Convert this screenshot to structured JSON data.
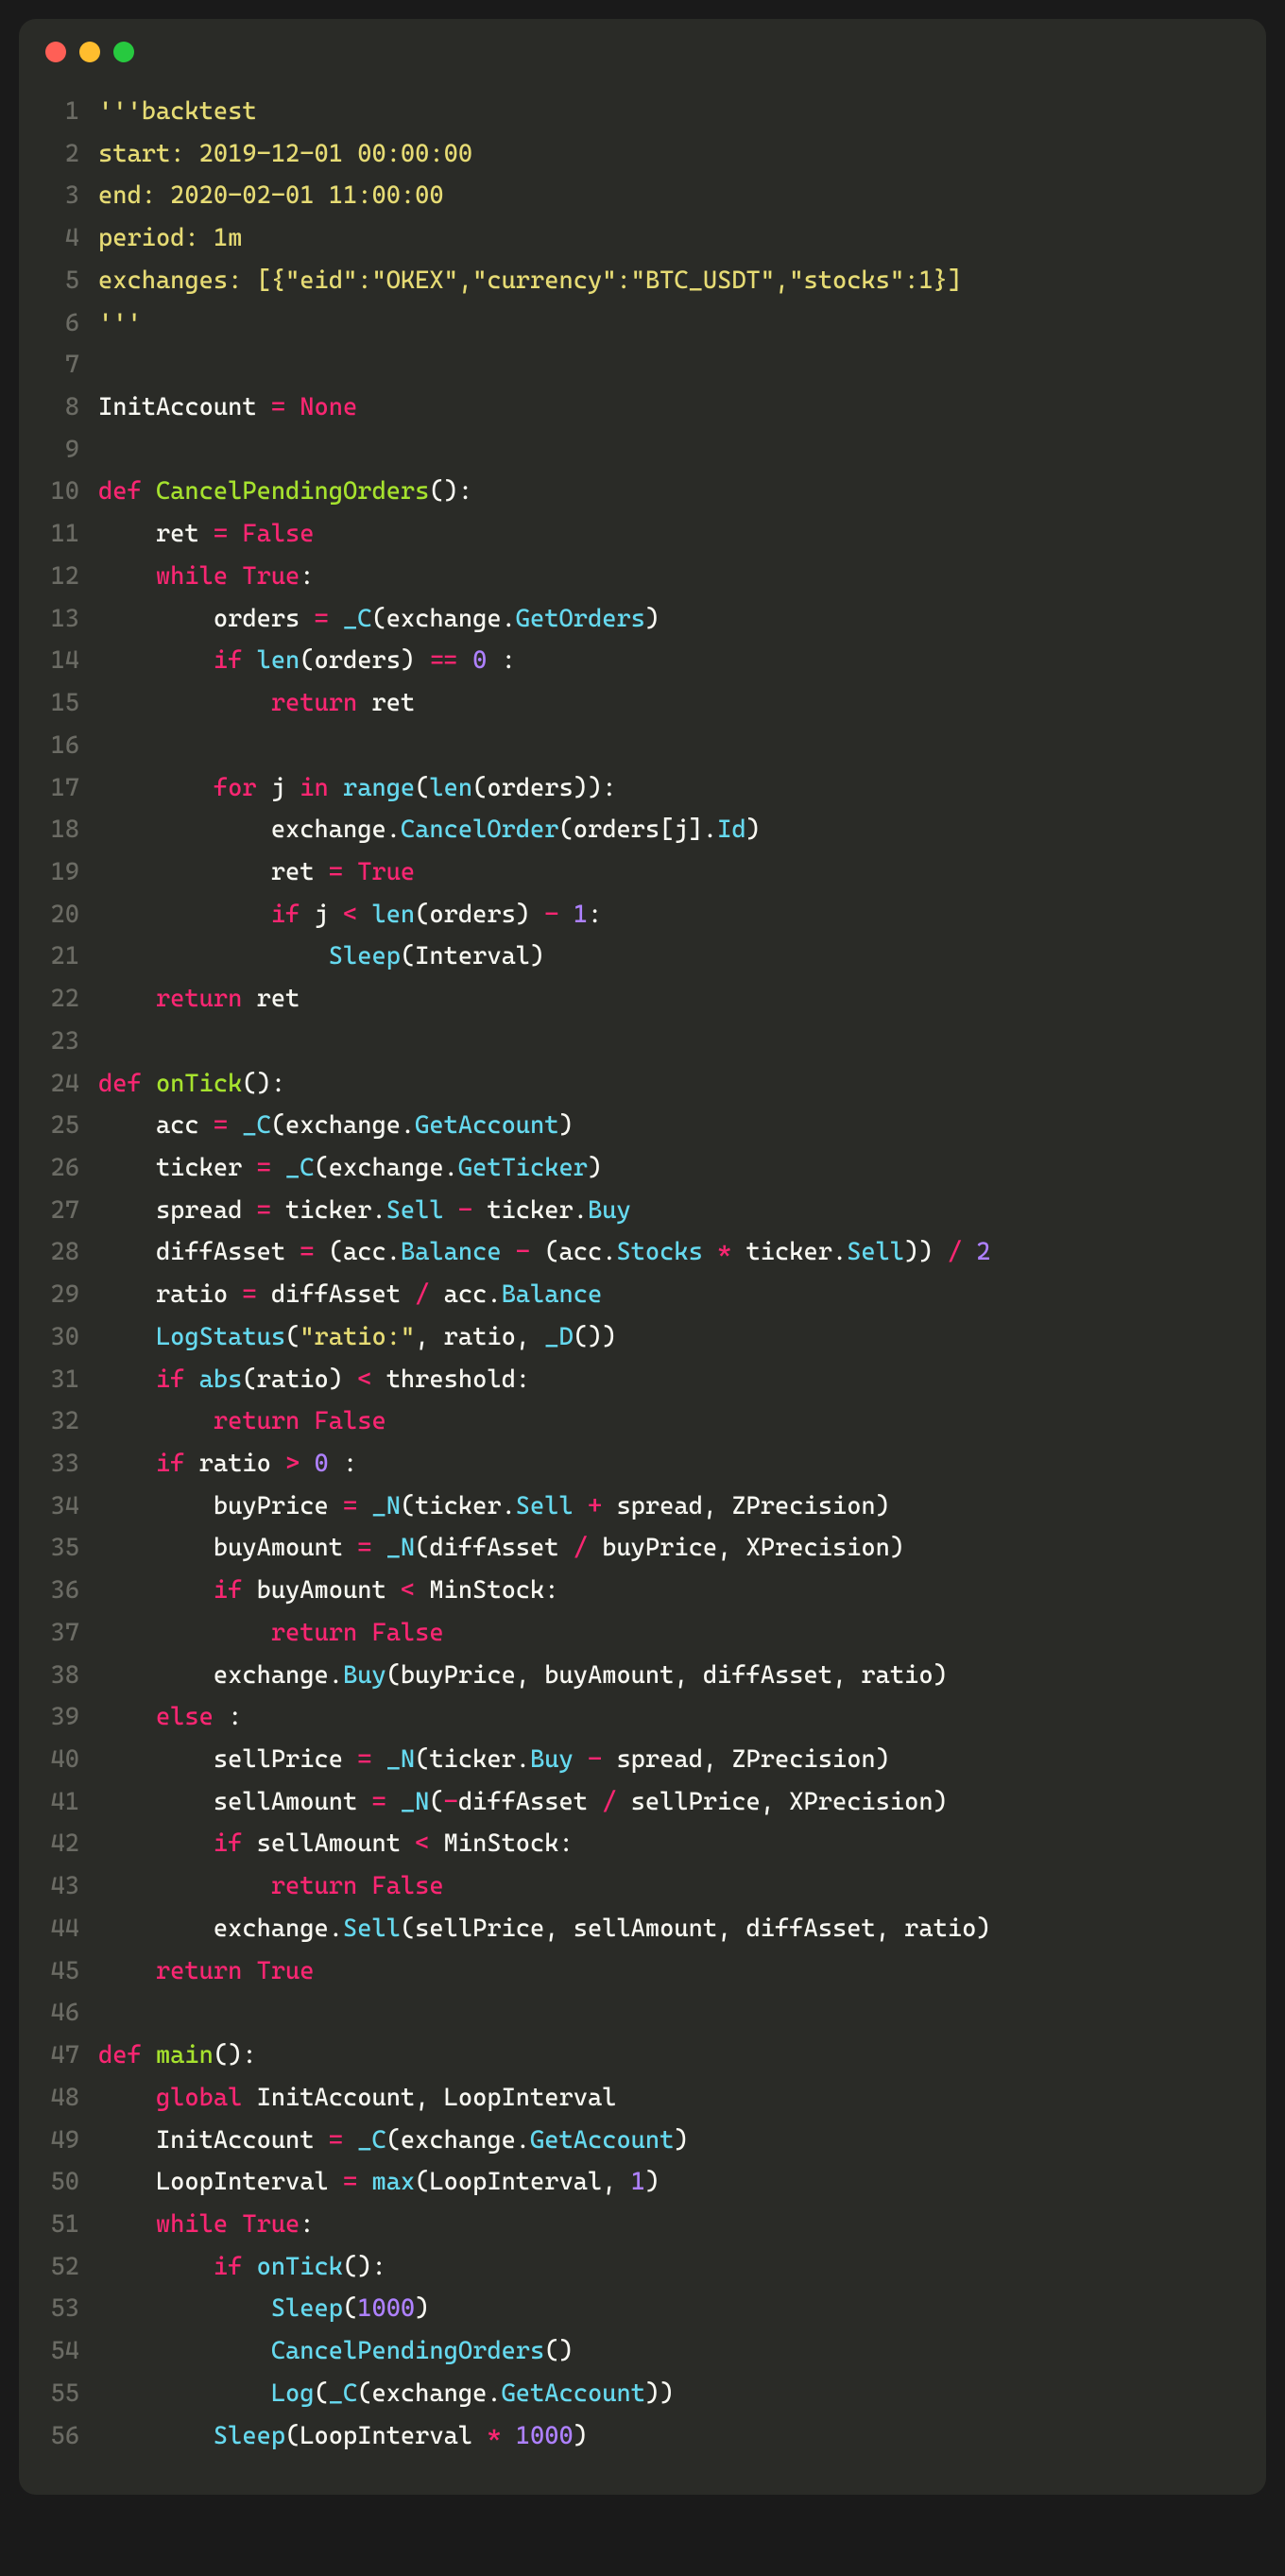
{
  "window": {
    "buttons": [
      "close",
      "minimize",
      "zoom"
    ]
  },
  "code_lines": [
    {
      "n": "1",
      "tokens": [
        [
          "c-str",
          "'''backtest"
        ]
      ]
    },
    {
      "n": "2",
      "tokens": [
        [
          "c-str",
          "start: 2019-12-01 00:00:00"
        ]
      ]
    },
    {
      "n": "3",
      "tokens": [
        [
          "c-str",
          "end: 2020-02-01 11:00:00"
        ]
      ]
    },
    {
      "n": "4",
      "tokens": [
        [
          "c-str",
          "period: 1m"
        ]
      ]
    },
    {
      "n": "5",
      "tokens": [
        [
          "c-str",
          "exchanges: [{\"eid\":\"OKEX\",\"currency\":\"BTC_USDT\",\"stocks\":1}]"
        ]
      ]
    },
    {
      "n": "6",
      "tokens": [
        [
          "c-str",
          "'''"
        ]
      ]
    },
    {
      "n": "7",
      "tokens": [
        [
          "c-plain",
          ""
        ]
      ]
    },
    {
      "n": "8",
      "tokens": [
        [
          "c-plain",
          "InitAccount "
        ],
        [
          "c-key",
          "="
        ],
        [
          "c-plain",
          " "
        ],
        [
          "c-key",
          "None"
        ]
      ]
    },
    {
      "n": "9",
      "tokens": [
        [
          "c-plain",
          ""
        ]
      ]
    },
    {
      "n": "10",
      "tokens": [
        [
          "c-key",
          "def"
        ],
        [
          "c-plain",
          " "
        ],
        [
          "c-name",
          "CancelPendingOrders"
        ],
        [
          "c-plain",
          "():"
        ]
      ]
    },
    {
      "n": "11",
      "tokens": [
        [
          "c-plain",
          "    ret "
        ],
        [
          "c-key",
          "="
        ],
        [
          "c-plain",
          " "
        ],
        [
          "c-key",
          "False"
        ]
      ]
    },
    {
      "n": "12",
      "tokens": [
        [
          "c-plain",
          "    "
        ],
        [
          "c-key",
          "while"
        ],
        [
          "c-plain",
          " "
        ],
        [
          "c-key",
          "True"
        ],
        [
          "c-plain",
          ":"
        ]
      ]
    },
    {
      "n": "13",
      "tokens": [
        [
          "c-plain",
          "        orders "
        ],
        [
          "c-key",
          "="
        ],
        [
          "c-plain",
          " "
        ],
        [
          "c-call",
          "_C"
        ],
        [
          "c-plain",
          "(exchange."
        ],
        [
          "c-call",
          "GetOrders"
        ],
        [
          "c-plain",
          ")"
        ]
      ]
    },
    {
      "n": "14",
      "tokens": [
        [
          "c-plain",
          "        "
        ],
        [
          "c-key",
          "if"
        ],
        [
          "c-plain",
          " "
        ],
        [
          "c-call",
          "len"
        ],
        [
          "c-plain",
          "(orders) "
        ],
        [
          "c-key",
          "=="
        ],
        [
          "c-plain",
          " "
        ],
        [
          "c-num",
          "0"
        ],
        [
          "c-plain",
          " :"
        ]
      ]
    },
    {
      "n": "15",
      "tokens": [
        [
          "c-plain",
          "            "
        ],
        [
          "c-key",
          "return"
        ],
        [
          "c-plain",
          " ret"
        ]
      ]
    },
    {
      "n": "16",
      "tokens": [
        [
          "c-plain",
          ""
        ]
      ]
    },
    {
      "n": "17",
      "tokens": [
        [
          "c-plain",
          "        "
        ],
        [
          "c-key",
          "for"
        ],
        [
          "c-plain",
          " j "
        ],
        [
          "c-key",
          "in"
        ],
        [
          "c-plain",
          " "
        ],
        [
          "c-call",
          "range"
        ],
        [
          "c-plain",
          "("
        ],
        [
          "c-call",
          "len"
        ],
        [
          "c-plain",
          "(orders)):"
        ]
      ]
    },
    {
      "n": "18",
      "tokens": [
        [
          "c-plain",
          "            exchange."
        ],
        [
          "c-call",
          "CancelOrder"
        ],
        [
          "c-plain",
          "(orders[j]."
        ],
        [
          "c-call",
          "Id"
        ],
        [
          "c-plain",
          ")"
        ]
      ]
    },
    {
      "n": "19",
      "tokens": [
        [
          "c-plain",
          "            ret "
        ],
        [
          "c-key",
          "="
        ],
        [
          "c-plain",
          " "
        ],
        [
          "c-key",
          "True"
        ]
      ]
    },
    {
      "n": "20",
      "tokens": [
        [
          "c-plain",
          "            "
        ],
        [
          "c-key",
          "if"
        ],
        [
          "c-plain",
          " j "
        ],
        [
          "c-key",
          "<"
        ],
        [
          "c-plain",
          " "
        ],
        [
          "c-call",
          "len"
        ],
        [
          "c-plain",
          "(orders) "
        ],
        [
          "c-key",
          "-"
        ],
        [
          "c-plain",
          " "
        ],
        [
          "c-num",
          "1"
        ],
        [
          "c-plain",
          ":"
        ]
      ]
    },
    {
      "n": "21",
      "tokens": [
        [
          "c-plain",
          "                "
        ],
        [
          "c-call",
          "Sleep"
        ],
        [
          "c-plain",
          "(Interval)"
        ]
      ]
    },
    {
      "n": "22",
      "tokens": [
        [
          "c-plain",
          "    "
        ],
        [
          "c-key",
          "return"
        ],
        [
          "c-plain",
          " ret"
        ]
      ]
    },
    {
      "n": "23",
      "tokens": [
        [
          "c-plain",
          ""
        ]
      ]
    },
    {
      "n": "24",
      "tokens": [
        [
          "c-key",
          "def"
        ],
        [
          "c-plain",
          " "
        ],
        [
          "c-name",
          "onTick"
        ],
        [
          "c-plain",
          "():"
        ]
      ]
    },
    {
      "n": "25",
      "tokens": [
        [
          "c-plain",
          "    acc "
        ],
        [
          "c-key",
          "="
        ],
        [
          "c-plain",
          " "
        ],
        [
          "c-call",
          "_C"
        ],
        [
          "c-plain",
          "(exchange."
        ],
        [
          "c-call",
          "GetAccount"
        ],
        [
          "c-plain",
          ")"
        ]
      ]
    },
    {
      "n": "26",
      "tokens": [
        [
          "c-plain",
          "    ticker "
        ],
        [
          "c-key",
          "="
        ],
        [
          "c-plain",
          " "
        ],
        [
          "c-call",
          "_C"
        ],
        [
          "c-plain",
          "(exchange."
        ],
        [
          "c-call",
          "GetTicker"
        ],
        [
          "c-plain",
          ")"
        ]
      ]
    },
    {
      "n": "27",
      "tokens": [
        [
          "c-plain",
          "    spread "
        ],
        [
          "c-key",
          "="
        ],
        [
          "c-plain",
          " ticker."
        ],
        [
          "c-call",
          "Sell"
        ],
        [
          "c-plain",
          " "
        ],
        [
          "c-key",
          "-"
        ],
        [
          "c-plain",
          " ticker."
        ],
        [
          "c-call",
          "Buy"
        ]
      ]
    },
    {
      "n": "28",
      "tokens": [
        [
          "c-plain",
          "    diffAsset "
        ],
        [
          "c-key",
          "="
        ],
        [
          "c-plain",
          " (acc."
        ],
        [
          "c-call",
          "Balance"
        ],
        [
          "c-plain",
          " "
        ],
        [
          "c-key",
          "-"
        ],
        [
          "c-plain",
          " (acc."
        ],
        [
          "c-call",
          "Stocks"
        ],
        [
          "c-plain",
          " "
        ],
        [
          "c-key",
          "*"
        ],
        [
          "c-plain",
          " ticker."
        ],
        [
          "c-call",
          "Sell"
        ],
        [
          "c-plain",
          ")) "
        ],
        [
          "c-key",
          "/"
        ],
        [
          "c-plain",
          " "
        ],
        [
          "c-num",
          "2"
        ]
      ]
    },
    {
      "n": "29",
      "tokens": [
        [
          "c-plain",
          "    ratio "
        ],
        [
          "c-key",
          "="
        ],
        [
          "c-plain",
          " diffAsset "
        ],
        [
          "c-key",
          "/"
        ],
        [
          "c-plain",
          " acc."
        ],
        [
          "c-call",
          "Balance"
        ]
      ]
    },
    {
      "n": "30",
      "tokens": [
        [
          "c-plain",
          "    "
        ],
        [
          "c-call",
          "LogStatus"
        ],
        [
          "c-plain",
          "("
        ],
        [
          "c-str",
          "\"ratio:\""
        ],
        [
          "c-plain",
          ", ratio, "
        ],
        [
          "c-call",
          "_D"
        ],
        [
          "c-plain",
          "())"
        ]
      ]
    },
    {
      "n": "31",
      "tokens": [
        [
          "c-plain",
          "    "
        ],
        [
          "c-key",
          "if"
        ],
        [
          "c-plain",
          " "
        ],
        [
          "c-call",
          "abs"
        ],
        [
          "c-plain",
          "(ratio) "
        ],
        [
          "c-key",
          "<"
        ],
        [
          "c-plain",
          " threshold:"
        ]
      ]
    },
    {
      "n": "32",
      "tokens": [
        [
          "c-plain",
          "        "
        ],
        [
          "c-key",
          "return"
        ],
        [
          "c-plain",
          " "
        ],
        [
          "c-key",
          "False"
        ]
      ]
    },
    {
      "n": "33",
      "tokens": [
        [
          "c-plain",
          "    "
        ],
        [
          "c-key",
          "if"
        ],
        [
          "c-plain",
          " ratio "
        ],
        [
          "c-key",
          ">"
        ],
        [
          "c-plain",
          " "
        ],
        [
          "c-num",
          "0"
        ],
        [
          "c-plain",
          " :"
        ]
      ]
    },
    {
      "n": "34",
      "tokens": [
        [
          "c-plain",
          "        buyPrice "
        ],
        [
          "c-key",
          "="
        ],
        [
          "c-plain",
          " "
        ],
        [
          "c-call",
          "_N"
        ],
        [
          "c-plain",
          "(ticker."
        ],
        [
          "c-call",
          "Sell"
        ],
        [
          "c-plain",
          " "
        ],
        [
          "c-key",
          "+"
        ],
        [
          "c-plain",
          " spread, ZPrecision)"
        ]
      ]
    },
    {
      "n": "35",
      "tokens": [
        [
          "c-plain",
          "        buyAmount "
        ],
        [
          "c-key",
          "="
        ],
        [
          "c-plain",
          " "
        ],
        [
          "c-call",
          "_N"
        ],
        [
          "c-plain",
          "(diffAsset "
        ],
        [
          "c-key",
          "/"
        ],
        [
          "c-plain",
          " buyPrice, XPrecision)"
        ]
      ]
    },
    {
      "n": "36",
      "tokens": [
        [
          "c-plain",
          "        "
        ],
        [
          "c-key",
          "if"
        ],
        [
          "c-plain",
          " buyAmount "
        ],
        [
          "c-key",
          "<"
        ],
        [
          "c-plain",
          " MinStock:"
        ]
      ]
    },
    {
      "n": "37",
      "tokens": [
        [
          "c-plain",
          "            "
        ],
        [
          "c-key",
          "return"
        ],
        [
          "c-plain",
          " "
        ],
        [
          "c-key",
          "False"
        ]
      ]
    },
    {
      "n": "38",
      "tokens": [
        [
          "c-plain",
          "        exchange."
        ],
        [
          "c-call",
          "Buy"
        ],
        [
          "c-plain",
          "(buyPrice, buyAmount, diffAsset, ratio)"
        ]
      ]
    },
    {
      "n": "39",
      "tokens": [
        [
          "c-plain",
          "    "
        ],
        [
          "c-key",
          "else"
        ],
        [
          "c-plain",
          " :"
        ]
      ]
    },
    {
      "n": "40",
      "tokens": [
        [
          "c-plain",
          "        sellPrice "
        ],
        [
          "c-key",
          "="
        ],
        [
          "c-plain",
          " "
        ],
        [
          "c-call",
          "_N"
        ],
        [
          "c-plain",
          "(ticker."
        ],
        [
          "c-call",
          "Buy"
        ],
        [
          "c-plain",
          " "
        ],
        [
          "c-key",
          "-"
        ],
        [
          "c-plain",
          " spread, ZPrecision)"
        ]
      ]
    },
    {
      "n": "41",
      "tokens": [
        [
          "c-plain",
          "        sellAmount "
        ],
        [
          "c-key",
          "="
        ],
        [
          "c-plain",
          " "
        ],
        [
          "c-call",
          "_N"
        ],
        [
          "c-plain",
          "("
        ],
        [
          "c-key",
          "-"
        ],
        [
          "c-plain",
          "diffAsset "
        ],
        [
          "c-key",
          "/"
        ],
        [
          "c-plain",
          " sellPrice, XPrecision)"
        ]
      ]
    },
    {
      "n": "42",
      "tokens": [
        [
          "c-plain",
          "        "
        ],
        [
          "c-key",
          "if"
        ],
        [
          "c-plain",
          " sellAmount "
        ],
        [
          "c-key",
          "<"
        ],
        [
          "c-plain",
          " MinStock:"
        ]
      ]
    },
    {
      "n": "43",
      "tokens": [
        [
          "c-plain",
          "            "
        ],
        [
          "c-key",
          "return"
        ],
        [
          "c-plain",
          " "
        ],
        [
          "c-key",
          "False"
        ]
      ]
    },
    {
      "n": "44",
      "tokens": [
        [
          "c-plain",
          "        exchange."
        ],
        [
          "c-call",
          "Sell"
        ],
        [
          "c-plain",
          "(sellPrice, sellAmount, diffAsset, ratio)"
        ]
      ]
    },
    {
      "n": "45",
      "tokens": [
        [
          "c-plain",
          "    "
        ],
        [
          "c-key",
          "return"
        ],
        [
          "c-plain",
          " "
        ],
        [
          "c-key",
          "True"
        ]
      ]
    },
    {
      "n": "46",
      "tokens": [
        [
          "c-plain",
          ""
        ]
      ]
    },
    {
      "n": "47",
      "tokens": [
        [
          "c-key",
          "def"
        ],
        [
          "c-plain",
          " "
        ],
        [
          "c-name",
          "main"
        ],
        [
          "c-plain",
          "():"
        ]
      ]
    },
    {
      "n": "48",
      "tokens": [
        [
          "c-plain",
          "    "
        ],
        [
          "c-key",
          "global"
        ],
        [
          "c-plain",
          " InitAccount, LoopInterval"
        ]
      ]
    },
    {
      "n": "49",
      "tokens": [
        [
          "c-plain",
          "    InitAccount "
        ],
        [
          "c-key",
          "="
        ],
        [
          "c-plain",
          " "
        ],
        [
          "c-call",
          "_C"
        ],
        [
          "c-plain",
          "(exchange."
        ],
        [
          "c-call",
          "GetAccount"
        ],
        [
          "c-plain",
          ")"
        ]
      ]
    },
    {
      "n": "50",
      "tokens": [
        [
          "c-plain",
          "    LoopInterval "
        ],
        [
          "c-key",
          "="
        ],
        [
          "c-plain",
          " "
        ],
        [
          "c-call",
          "max"
        ],
        [
          "c-plain",
          "(LoopInterval, "
        ],
        [
          "c-num",
          "1"
        ],
        [
          "c-plain",
          ")"
        ]
      ]
    },
    {
      "n": "51",
      "tokens": [
        [
          "c-plain",
          "    "
        ],
        [
          "c-key",
          "while"
        ],
        [
          "c-plain",
          " "
        ],
        [
          "c-key",
          "True"
        ],
        [
          "c-plain",
          ":"
        ]
      ]
    },
    {
      "n": "52",
      "tokens": [
        [
          "c-plain",
          "        "
        ],
        [
          "c-key",
          "if"
        ],
        [
          "c-plain",
          " "
        ],
        [
          "c-call",
          "onTick"
        ],
        [
          "c-plain",
          "():"
        ]
      ]
    },
    {
      "n": "53",
      "tokens": [
        [
          "c-plain",
          "            "
        ],
        [
          "c-call",
          "Sleep"
        ],
        [
          "c-plain",
          "("
        ],
        [
          "c-num",
          "1000"
        ],
        [
          "c-plain",
          ")"
        ]
      ]
    },
    {
      "n": "54",
      "tokens": [
        [
          "c-plain",
          "            "
        ],
        [
          "c-call",
          "CancelPendingOrders"
        ],
        [
          "c-plain",
          "()"
        ]
      ]
    },
    {
      "n": "55",
      "tokens": [
        [
          "c-plain",
          "            "
        ],
        [
          "c-call",
          "Log"
        ],
        [
          "c-plain",
          "("
        ],
        [
          "c-call",
          "_C"
        ],
        [
          "c-plain",
          "(exchange."
        ],
        [
          "c-call",
          "GetAccount"
        ],
        [
          "c-plain",
          "))"
        ]
      ]
    },
    {
      "n": "56",
      "tokens": [
        [
          "c-plain",
          "        "
        ],
        [
          "c-call",
          "Sleep"
        ],
        [
          "c-plain",
          "(LoopInterval "
        ],
        [
          "c-key",
          "*"
        ],
        [
          "c-plain",
          " "
        ],
        [
          "c-num",
          "1000"
        ],
        [
          "c-plain",
          ")"
        ]
      ]
    }
  ]
}
